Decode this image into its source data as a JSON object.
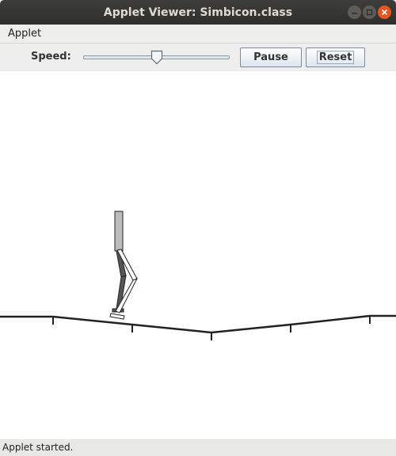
{
  "window": {
    "title": "Applet Viewer: Simbicon.class",
    "buttons": [
      "minimize-icon",
      "maximize-icon",
      "close-icon"
    ],
    "accent_close": "#e9541f"
  },
  "menubar": {
    "items": [
      {
        "label": "Applet"
      }
    ]
  },
  "controls": {
    "speed_label": "Speed:",
    "speed_level_fraction": 0.5,
    "pause_label": "Pause",
    "reset_label": "Reset"
  },
  "simulation": {
    "background": "#ffffff",
    "ground_color": "#222222",
    "figure": "biped walker"
  },
  "status": {
    "text": "Applet started."
  }
}
